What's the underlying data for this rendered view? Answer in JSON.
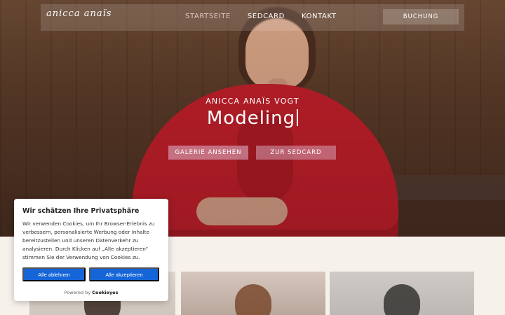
{
  "header": {
    "logo_text": "anicca anaïs",
    "menu": [
      {
        "label": "STARTSEITE",
        "active": true
      },
      {
        "label": "SEDCARD",
        "active": false
      },
      {
        "label": "KONTAKT",
        "active": false
      }
    ],
    "booking_label": "BUCHUNG"
  },
  "hero": {
    "name": "ANICCA ANAÏS VOGT",
    "role": "Modeling",
    "buttons": {
      "gallery": "GALERIE ANSEHEN",
      "sedcard": "ZUR SEDCARD"
    }
  },
  "cookie_banner": {
    "title": "Wir schätzen Ihre Privatsphäre",
    "text": "Wir verwenden Cookies, um Ihr Browser-Erlebnis zu verbessern, personalisierte Werbung oder Inhalte bereitzustellen und unseren Datenverkehr zu analysieren. Durch Klicken auf „Alle akzeptieren“ stimmen Sie der Verwendung von Cookies zu.",
    "reject_label": "Alle ablehnen",
    "accept_label": "Alle akzeptieren",
    "powered_by_prefix": "Powered by",
    "powered_by_brand": "Cookieyes"
  },
  "colors": {
    "primary_button": "#1565d8",
    "hero_button": "#d6a0b5",
    "coat_red": "#c11f2a",
    "background": "#f7f1ec"
  }
}
